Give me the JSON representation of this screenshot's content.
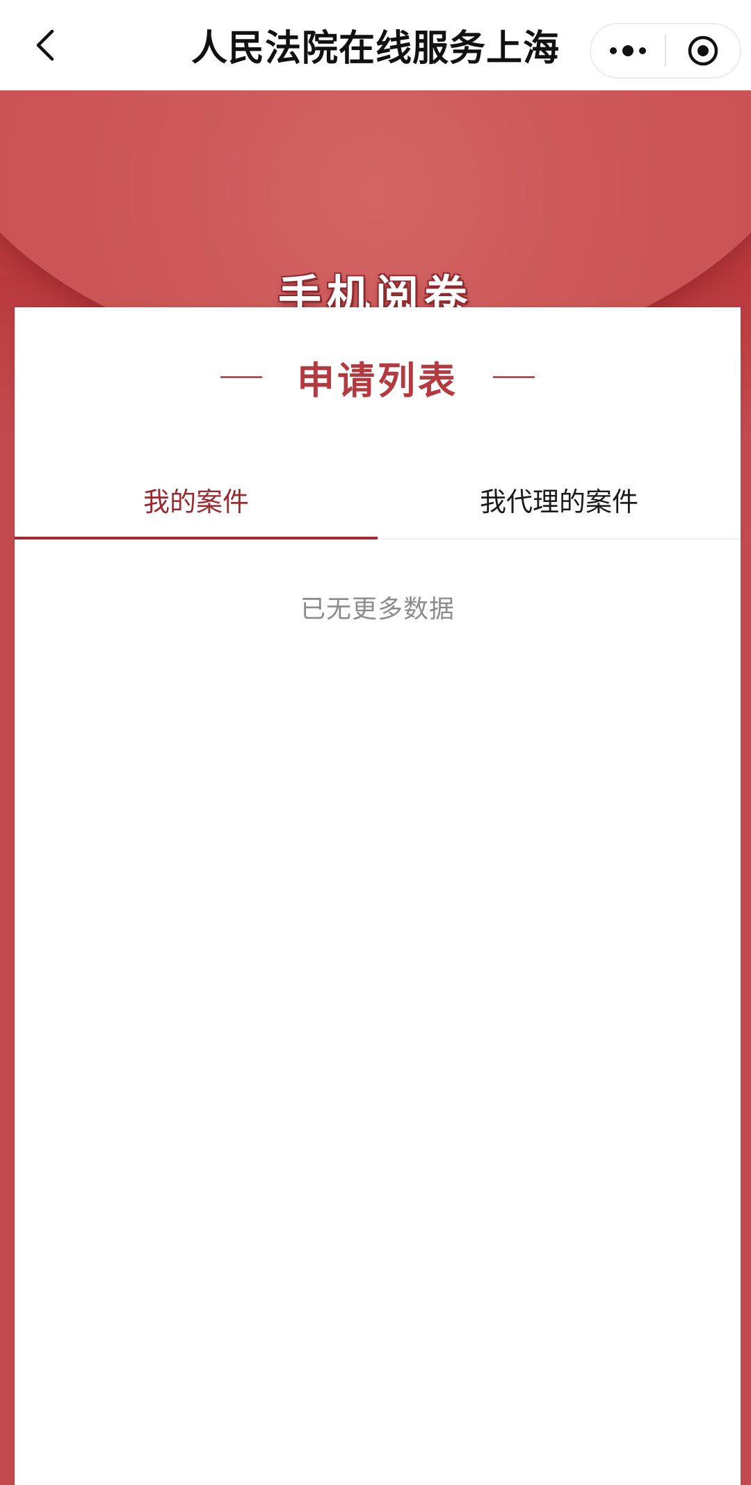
{
  "navbar": {
    "title": "人民法院在线服务上海",
    "back_icon": "chevron-left-icon",
    "more_icon": "more-dots-icon",
    "close_icon": "target-circle-icon"
  },
  "header": {
    "title": "手机阅卷"
  },
  "card": {
    "heading": "申请列表",
    "tabs": [
      {
        "label": "我的案件",
        "active": true
      },
      {
        "label": "我代理的案件",
        "active": false
      }
    ],
    "empty_text": "已无更多数据"
  },
  "colors": {
    "brand_red": "#c34b4f",
    "active_tab": "#9b2a2f",
    "heading": "#b53a40"
  }
}
